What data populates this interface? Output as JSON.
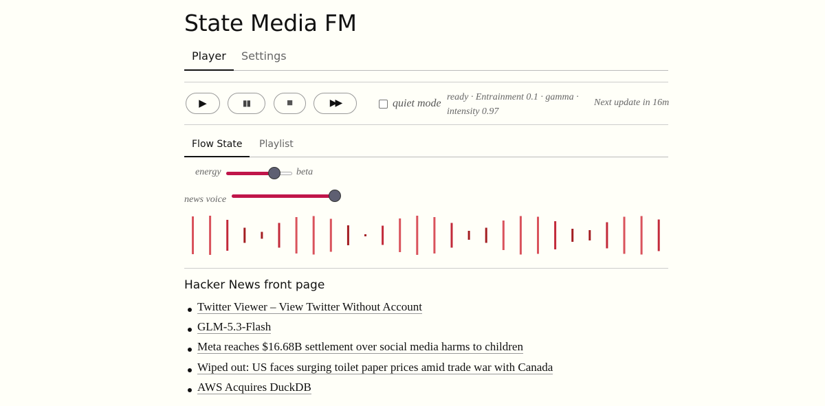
{
  "app": {
    "title": "State Media FM"
  },
  "main_tabs": [
    {
      "label": "Player",
      "active": true
    },
    {
      "label": "Settings",
      "active": false
    }
  ],
  "controls": {
    "play": "▶",
    "pause": "▮▮",
    "stop": "■",
    "fast_forward": "▶▶",
    "quiet_mode_label": "quiet mode",
    "quiet_mode_checked": false,
    "status": "ready · Entrainment 0.1 · gamma · intensity 0.97",
    "next_update": "Next update in 16m"
  },
  "sub_tabs": [
    {
      "label": "Flow State",
      "active": true
    },
    {
      "label": "Playlist",
      "active": false
    }
  ],
  "sliders": {
    "energy_label": "energy",
    "beta_label": "beta",
    "energy_value": 0.73,
    "news_voice_label": "news voice",
    "news_voice_value": 1.0
  },
  "visualizer": {
    "heights": [
      55,
      57,
      45,
      22,
      10,
      36,
      53,
      56,
      48,
      29,
      3,
      28,
      49,
      57,
      53,
      36,
      13,
      22,
      43,
      56,
      54,
      41,
      19,
      15,
      38,
      54,
      56,
      46
    ],
    "colors": [
      "#d9535c",
      "#d9535c",
      "#c22a3a",
      "#a31e22",
      "#a31e22",
      "#c22a3a",
      "#d9535c",
      "#d9535c",
      "#d9535c",
      "#a31e22",
      "#a31e22",
      "#c22a3a",
      "#d9535c",
      "#d9535c",
      "#d9535c",
      "#c22a3a",
      "#a31e22",
      "#a31e22",
      "#d9535c",
      "#d9535c",
      "#d9535c",
      "#c22a3a",
      "#a31e22",
      "#a31e22",
      "#c22a3a",
      "#d9535c",
      "#d9535c",
      "#c22a3a"
    ]
  },
  "news": {
    "title": "Hacker News front page",
    "items": [
      "Twitter Viewer – View Twitter Without Account",
      "GLM-5.3-Flash",
      "Meta reaches $16.68B settlement over social media harms to children",
      "Wiped out: US faces surging toilet paper prices amid trade war with Canada",
      "AWS Acquires DuckDB"
    ]
  }
}
